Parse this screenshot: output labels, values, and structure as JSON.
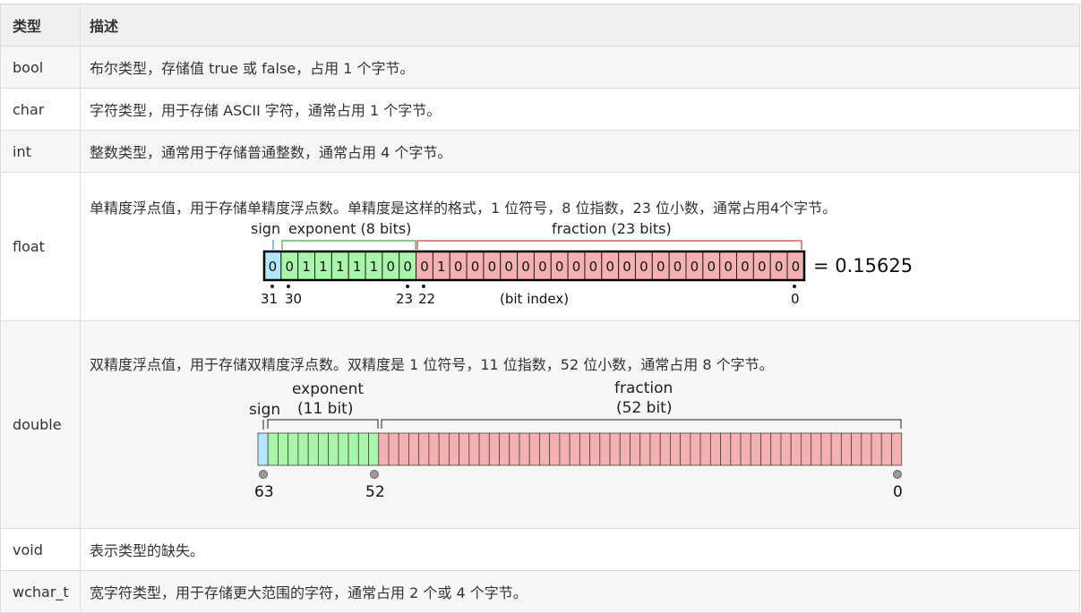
{
  "headers": {
    "type": "类型",
    "desc": "描述"
  },
  "rows": [
    {
      "type": "bool",
      "desc": "布尔类型，存储值 true 或 false，占用 1 个字节。"
    },
    {
      "type": "char",
      "desc": "字符类型，用于存储 ASCII 字符，通常占用 1 个字节。"
    },
    {
      "type": "int",
      "desc": "整数类型，通常用于存储普通整数，通常占用 4 个字节。"
    },
    {
      "type": "float",
      "desc": "单精度浮点值，用于存储单精度浮点数。单精度是这样的格式，1 位符号，8 位指数，23 位小数，通常占用4个字节。"
    },
    {
      "type": "double",
      "desc": "双精度浮点值，用于存储双精度浮点数。双精度是 1 位符号，11 位指数，52 位小数，通常占用 8 个字节。"
    },
    {
      "type": "void",
      "desc": "表示类型的缺失。"
    },
    {
      "type": "wchar_t",
      "desc": "宽字符类型，用于存储更大范围的字符，通常占用 2 个或 4 个字节。"
    }
  ],
  "float_diagram": {
    "sign_label": "sign",
    "exponent_label": "exponent (8 bits)",
    "fraction_label": "fraction (23 bits)",
    "bits": "00111110001000000000000000000000",
    "result": "= 0.15625",
    "index_labels": {
      "i31": "31",
      "i30": "30",
      "i23": "23",
      "i22": "22",
      "i0": "0"
    },
    "bit_index_label": "(bit index)",
    "colors": {
      "sign": "#b3e5fc",
      "exponent": "#a9f5a9",
      "fraction": "#f5b1b1"
    }
  },
  "double_diagram": {
    "sign_label": "sign",
    "exponent_label_line1": "exponent",
    "exponent_label_line2": "(11 bit)",
    "fraction_label_line1": "fraction",
    "fraction_label_line2": "(52 bit)",
    "index_labels": {
      "i63": "63",
      "i52": "52",
      "i0": "0"
    },
    "colors": {
      "sign": "#b3e5fc",
      "exponent": "#a9f5a9",
      "fraction": "#f5b1b1"
    }
  }
}
